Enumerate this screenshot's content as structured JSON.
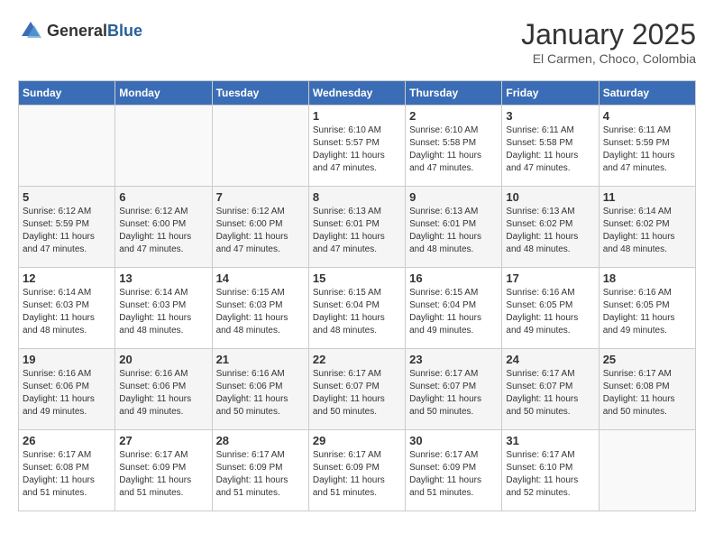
{
  "header": {
    "logo_general": "General",
    "logo_blue": "Blue",
    "month": "January 2025",
    "location": "El Carmen, Choco, Colombia"
  },
  "days_of_week": [
    "Sunday",
    "Monday",
    "Tuesday",
    "Wednesday",
    "Thursday",
    "Friday",
    "Saturday"
  ],
  "weeks": [
    [
      {
        "day": "",
        "info": ""
      },
      {
        "day": "",
        "info": ""
      },
      {
        "day": "",
        "info": ""
      },
      {
        "day": "1",
        "info": "Sunrise: 6:10 AM\nSunset: 5:57 PM\nDaylight: 11 hours\nand 47 minutes."
      },
      {
        "day": "2",
        "info": "Sunrise: 6:10 AM\nSunset: 5:58 PM\nDaylight: 11 hours\nand 47 minutes."
      },
      {
        "day": "3",
        "info": "Sunrise: 6:11 AM\nSunset: 5:58 PM\nDaylight: 11 hours\nand 47 minutes."
      },
      {
        "day": "4",
        "info": "Sunrise: 6:11 AM\nSunset: 5:59 PM\nDaylight: 11 hours\nand 47 minutes."
      }
    ],
    [
      {
        "day": "5",
        "info": "Sunrise: 6:12 AM\nSunset: 5:59 PM\nDaylight: 11 hours\nand 47 minutes."
      },
      {
        "day": "6",
        "info": "Sunrise: 6:12 AM\nSunset: 6:00 PM\nDaylight: 11 hours\nand 47 minutes."
      },
      {
        "day": "7",
        "info": "Sunrise: 6:12 AM\nSunset: 6:00 PM\nDaylight: 11 hours\nand 47 minutes."
      },
      {
        "day": "8",
        "info": "Sunrise: 6:13 AM\nSunset: 6:01 PM\nDaylight: 11 hours\nand 47 minutes."
      },
      {
        "day": "9",
        "info": "Sunrise: 6:13 AM\nSunset: 6:01 PM\nDaylight: 11 hours\nand 48 minutes."
      },
      {
        "day": "10",
        "info": "Sunrise: 6:13 AM\nSunset: 6:02 PM\nDaylight: 11 hours\nand 48 minutes."
      },
      {
        "day": "11",
        "info": "Sunrise: 6:14 AM\nSunset: 6:02 PM\nDaylight: 11 hours\nand 48 minutes."
      }
    ],
    [
      {
        "day": "12",
        "info": "Sunrise: 6:14 AM\nSunset: 6:03 PM\nDaylight: 11 hours\nand 48 minutes."
      },
      {
        "day": "13",
        "info": "Sunrise: 6:14 AM\nSunset: 6:03 PM\nDaylight: 11 hours\nand 48 minutes."
      },
      {
        "day": "14",
        "info": "Sunrise: 6:15 AM\nSunset: 6:03 PM\nDaylight: 11 hours\nand 48 minutes."
      },
      {
        "day": "15",
        "info": "Sunrise: 6:15 AM\nSunset: 6:04 PM\nDaylight: 11 hours\nand 48 minutes."
      },
      {
        "day": "16",
        "info": "Sunrise: 6:15 AM\nSunset: 6:04 PM\nDaylight: 11 hours\nand 49 minutes."
      },
      {
        "day": "17",
        "info": "Sunrise: 6:16 AM\nSunset: 6:05 PM\nDaylight: 11 hours\nand 49 minutes."
      },
      {
        "day": "18",
        "info": "Sunrise: 6:16 AM\nSunset: 6:05 PM\nDaylight: 11 hours\nand 49 minutes."
      }
    ],
    [
      {
        "day": "19",
        "info": "Sunrise: 6:16 AM\nSunset: 6:06 PM\nDaylight: 11 hours\nand 49 minutes."
      },
      {
        "day": "20",
        "info": "Sunrise: 6:16 AM\nSunset: 6:06 PM\nDaylight: 11 hours\nand 49 minutes."
      },
      {
        "day": "21",
        "info": "Sunrise: 6:16 AM\nSunset: 6:06 PM\nDaylight: 11 hours\nand 50 minutes."
      },
      {
        "day": "22",
        "info": "Sunrise: 6:17 AM\nSunset: 6:07 PM\nDaylight: 11 hours\nand 50 minutes."
      },
      {
        "day": "23",
        "info": "Sunrise: 6:17 AM\nSunset: 6:07 PM\nDaylight: 11 hours\nand 50 minutes."
      },
      {
        "day": "24",
        "info": "Sunrise: 6:17 AM\nSunset: 6:07 PM\nDaylight: 11 hours\nand 50 minutes."
      },
      {
        "day": "25",
        "info": "Sunrise: 6:17 AM\nSunset: 6:08 PM\nDaylight: 11 hours\nand 50 minutes."
      }
    ],
    [
      {
        "day": "26",
        "info": "Sunrise: 6:17 AM\nSunset: 6:08 PM\nDaylight: 11 hours\nand 51 minutes."
      },
      {
        "day": "27",
        "info": "Sunrise: 6:17 AM\nSunset: 6:09 PM\nDaylight: 11 hours\nand 51 minutes."
      },
      {
        "day": "28",
        "info": "Sunrise: 6:17 AM\nSunset: 6:09 PM\nDaylight: 11 hours\nand 51 minutes."
      },
      {
        "day": "29",
        "info": "Sunrise: 6:17 AM\nSunset: 6:09 PM\nDaylight: 11 hours\nand 51 minutes."
      },
      {
        "day": "30",
        "info": "Sunrise: 6:17 AM\nSunset: 6:09 PM\nDaylight: 11 hours\nand 51 minutes."
      },
      {
        "day": "31",
        "info": "Sunrise: 6:17 AM\nSunset: 6:10 PM\nDaylight: 11 hours\nand 52 minutes."
      },
      {
        "day": "",
        "info": ""
      }
    ]
  ]
}
